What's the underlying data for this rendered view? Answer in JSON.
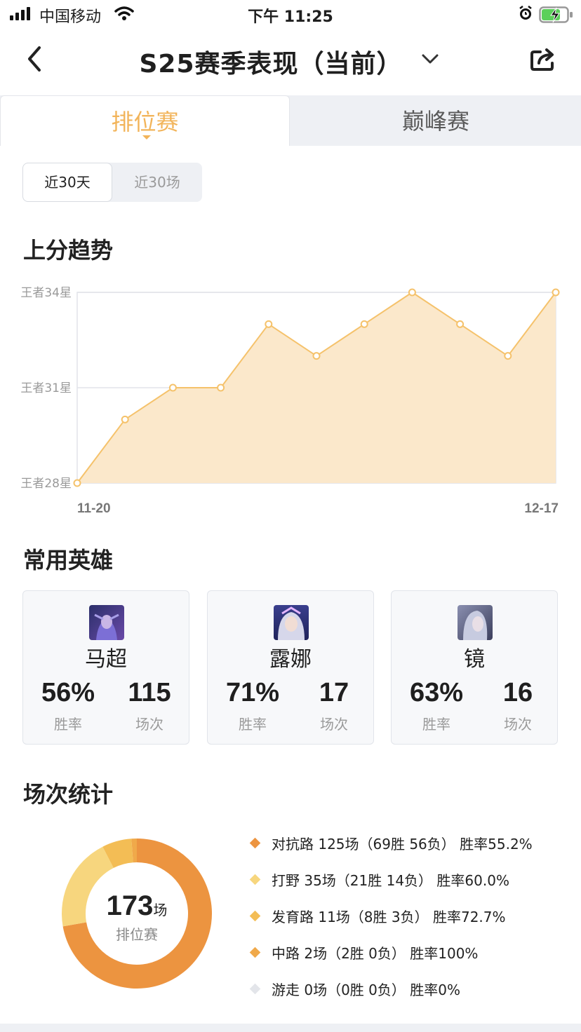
{
  "status_bar": {
    "carrier": "中国移动",
    "time": "下午 11:25"
  },
  "nav": {
    "title": "S25赛季表现（当前）"
  },
  "tabs": [
    {
      "label": "排位赛",
      "active": true
    },
    {
      "label": "巅峰赛",
      "active": false
    }
  ],
  "range_toggle": [
    {
      "label": "近30天",
      "active": true
    },
    {
      "label": "近30场",
      "active": false
    }
  ],
  "trend": {
    "heading": "上分趋势",
    "chart_data": {
      "type": "area",
      "y_tick_labels": [
        "王者34星",
        "王者31星",
        "王者28星"
      ],
      "x_tick_labels": [
        "11-20",
        "12-17"
      ],
      "ylim": [
        28,
        34
      ],
      "values": [
        28,
        30,
        31,
        31,
        33,
        32,
        33,
        34,
        33,
        32,
        34
      ],
      "color": "#f5c26b",
      "fill": "#fbe8cb"
    }
  },
  "heroes": {
    "heading": "常用英雄",
    "items": [
      {
        "name": "马超",
        "win_rate": "56%",
        "win_label": "胜率",
        "games": "115",
        "games_label": "场次"
      },
      {
        "name": "露娜",
        "win_rate": "71%",
        "win_label": "胜率",
        "games": "17",
        "games_label": "场次"
      },
      {
        "name": "镜",
        "win_rate": "63%",
        "win_label": "胜率",
        "games": "16",
        "games_label": "场次"
      }
    ]
  },
  "stats": {
    "heading": "场次统计",
    "total": "173",
    "total_unit": "场",
    "total_label": "排位赛",
    "chart_data": {
      "type": "pie",
      "categories": [
        "对抗路",
        "打野",
        "发育路",
        "中路",
        "游走"
      ],
      "values": [
        125,
        35,
        11,
        2,
        0
      ],
      "colors": [
        "#ec9440",
        "#f7d67e",
        "#f3bd55",
        "#f0a94a",
        "#e3e5ea"
      ]
    },
    "legend": [
      {
        "text": "对抗路 125场（69胜 56负） 胜率55.2%",
        "color": "#ec9440"
      },
      {
        "text": "打野 35场（21胜 14负） 胜率60.0%",
        "color": "#f7d67e"
      },
      {
        "text": "发育路 11场（8胜 3负） 胜率72.7%",
        "color": "#f3bd55"
      },
      {
        "text": "中路 2场（2胜 0负） 胜率100%",
        "color": "#f0a94a"
      },
      {
        "text": "游走 0场（0胜 0负） 胜率0%",
        "color": "#e3e5ea"
      }
    ]
  }
}
